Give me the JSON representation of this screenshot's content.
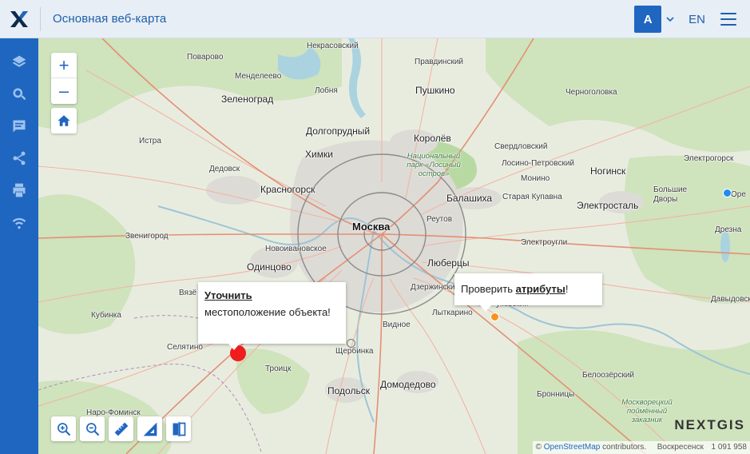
{
  "header": {
    "title": "Основная веб-карта",
    "user_initial": "A",
    "language": "EN"
  },
  "sidebar": {
    "items": [
      {
        "name": "layers-icon"
      },
      {
        "name": "search-icon"
      },
      {
        "name": "comment-icon"
      },
      {
        "name": "share-icon"
      },
      {
        "name": "print-icon"
      },
      {
        "name": "wifi-icon"
      }
    ]
  },
  "map": {
    "zoom_in": "+",
    "zoom_out": "–",
    "labels": {
      "nekrasovsky": "Некрасовский",
      "pravdinsky": "Правдинский",
      "povarovo": "Поварово",
      "mendeleevo": "Менделеево",
      "lobnya": "Лобня",
      "pushkino": "Пушкино",
      "chernogolovka": "Черноголовка",
      "zelenograd": "Зеленоград",
      "dolgoprudny": "Долгопрудный",
      "istra": "Истра",
      "khimki": "Химки",
      "korolev": "Королёв",
      "sverdlovsky": "Свердловский",
      "losino": "Лосино-Петровский",
      "elektrogorsk": "Электрогорск",
      "losiny_park": "Национальный парк «Лосиный остров»",
      "dedovsk": "Дедовск",
      "monino": "Монино",
      "noginsk": "Ногинск",
      "krasnogorsk": "Красногорск",
      "balashikha": "Балашиха",
      "staraya_kupavna": "Старая Купавна",
      "bolshie_dvory": "Большие Дворы",
      "elektrostal": "Электросталь",
      "moskva": "Москва",
      "reutov": "Реутов",
      "zvenigorod": "Звенигород",
      "elektrougli": "Электроугли",
      "drezna": "Дрезна",
      "novoivanovskoe": "Новоивановское",
      "odintsovo": "Одинцово",
      "lyubertsy": "Люберцы",
      "dzerzhinsky": "Дзержинский",
      "kubinka": "Кубинка",
      "lytkarino": "Лыткарино",
      "vidnoe": "Видное",
      "davydovskoe": "Давыдовское",
      "selyatino": "Селятино",
      "shcherbinka": "Щербинка",
      "troitsk": "Троицк",
      "belozersky": "Белоозёрский",
      "podolsk": "Подольск",
      "domodedovo": "Домодедово",
      "bronnitsy": "Бронницы",
      "naro_fominsk": "Наро-Фоминск",
      "moskvoretsky": "Москворецкий поймённый заказник",
      "vyazyomy": "Вязё",
      "ukovsky": "уковский",
      "orekhovo": "Оре"
    },
    "popup1": {
      "link": "Уточнить",
      "text": "местоположение объекта!"
    },
    "popup2": {
      "prefix": "Проверить ",
      "link": "атрибуты",
      "suffix": "!"
    },
    "brand": "NEXTGIS",
    "attribution_link": "OpenStreetMap",
    "attribution_text": " contributors.",
    "scale_text": "Воскресенск",
    "scale_number": "1 091 958"
  },
  "colors": {
    "accent": "#1f66c0",
    "marker_red": "#f01d1d",
    "marker_orange": "#f7931e",
    "marker_blue": "#1e8cf0"
  }
}
